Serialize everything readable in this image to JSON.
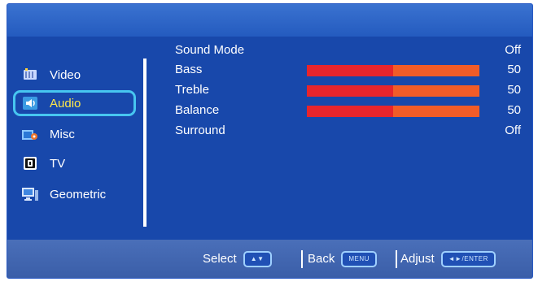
{
  "sidebar": {
    "items": [
      {
        "label": "Video",
        "icon": "video-icon"
      },
      {
        "label": "Audio",
        "icon": "audio-icon",
        "selected": true
      },
      {
        "label": "Misc",
        "icon": "misc-icon"
      },
      {
        "label": "TV",
        "icon": "tv-icon"
      },
      {
        "label": "Geometric",
        "icon": "geometric-icon"
      }
    ]
  },
  "settings": {
    "sound_mode": {
      "label": "Sound Mode",
      "value": "Off"
    },
    "bass": {
      "label": "Bass",
      "value": "50",
      "level": 0.5
    },
    "treble": {
      "label": "Treble",
      "value": "50",
      "level": 0.5
    },
    "balance": {
      "label": "Balance",
      "value": "50",
      "level": 0.5
    },
    "surround": {
      "label": "Surround",
      "value": "Off"
    }
  },
  "footer": {
    "select_label": "Select",
    "select_key": "▲▼",
    "back_label": "Back",
    "back_key": "MENU",
    "adjust_label": "Adjust",
    "adjust_key": "◄►/ENTER"
  },
  "colors": {
    "background": "#1848ab",
    "selected_text": "#ffe84a",
    "selection_border": "#47c6f0",
    "bar_fill": "#e8252c",
    "bar_track": "#f25c28"
  }
}
